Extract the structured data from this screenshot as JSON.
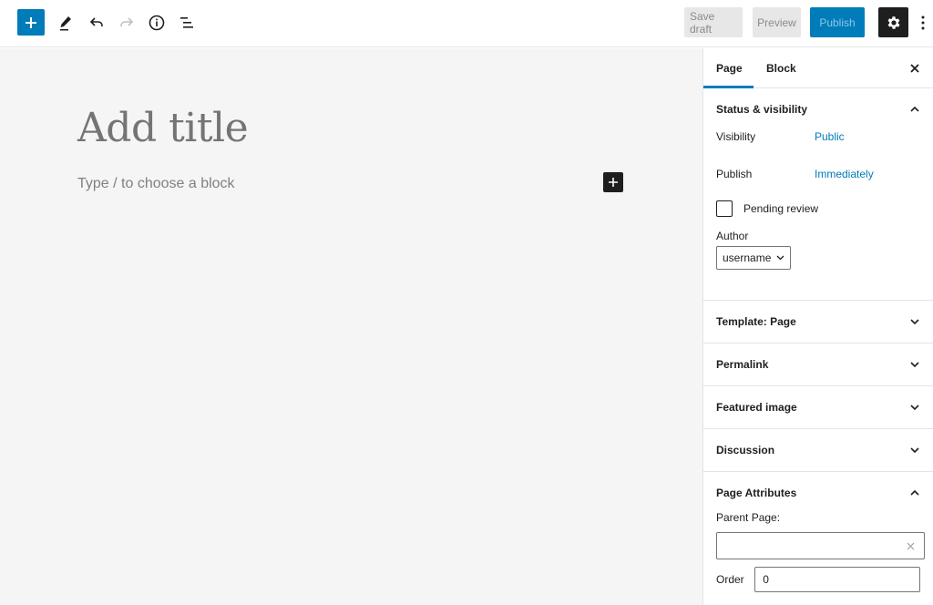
{
  "toolbar": {
    "add_block_label": "Add block",
    "save_draft": "Save draft",
    "preview": "Preview",
    "publish": "Publish",
    "icons": [
      "plus-icon",
      "pencil-icon",
      "undo-icon",
      "redo-icon",
      "info-icon",
      "list-view-icon",
      "gear-icon",
      "more-vertical-icon"
    ]
  },
  "editor": {
    "title_placeholder": "Add title",
    "block_placeholder": "Type / to choose a block"
  },
  "sidebar": {
    "tabs": [
      {
        "label": "Page",
        "active": true
      },
      {
        "label": "Block",
        "active": false
      }
    ],
    "status_visibility": {
      "title": "Status & visibility",
      "expanded": true,
      "visibility_label": "Visibility",
      "visibility_value": "Public",
      "publish_label": "Publish",
      "publish_value": "Immediately",
      "pending_review_label": "Pending review",
      "pending_review_checked": false,
      "author_label": "Author",
      "author_value": "username"
    },
    "collapsed_panels": [
      {
        "title": "Template: Page"
      },
      {
        "title": "Permalink"
      },
      {
        "title": "Featured image"
      },
      {
        "title": "Discussion"
      }
    ],
    "page_attributes": {
      "title": "Page Attributes",
      "expanded": true,
      "parent_label": "Parent Page:",
      "parent_value": "",
      "order_label": "Order",
      "order_value": "0"
    }
  },
  "colors": {
    "accent": "#007cba",
    "dark": "#1e1e1e",
    "editor_bg": "#f5f5f5"
  }
}
